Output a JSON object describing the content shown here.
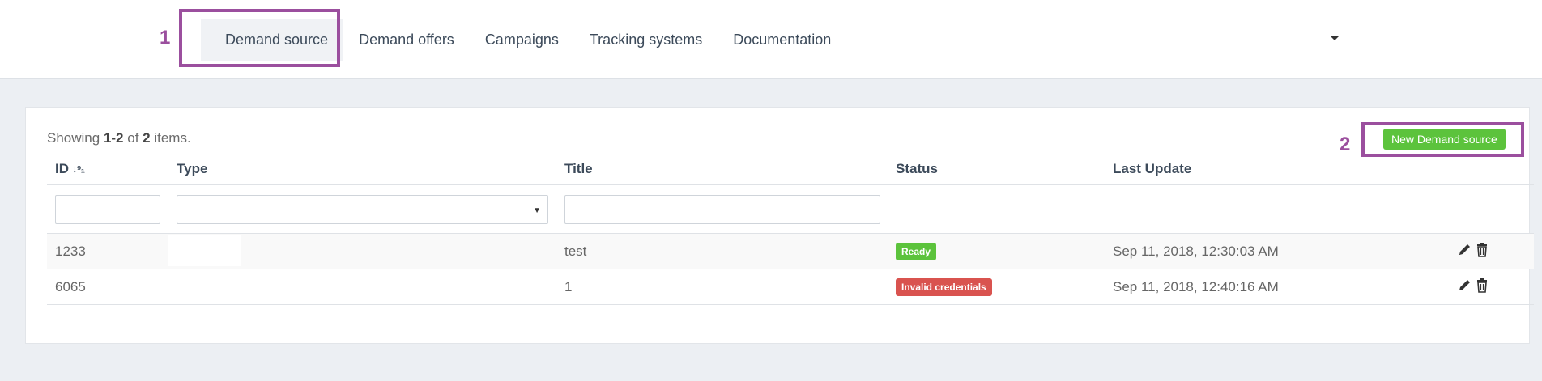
{
  "nav": {
    "items": [
      "Demand source",
      "Demand offers",
      "Campaigns",
      "Tracking systems",
      "Documentation"
    ]
  },
  "annotations": {
    "box1": "1",
    "box2": "2"
  },
  "summary": {
    "prefix": "Showing ",
    "range": "1-2",
    "middle": " of ",
    "total": "2",
    "suffix": " items."
  },
  "new_button": "New Demand source",
  "columns": {
    "id": "ID",
    "type": "Type",
    "title": "Title",
    "status": "Status",
    "last_update": "Last Update"
  },
  "rows": [
    {
      "id": "1233",
      "type": "",
      "title": "test",
      "status": "Ready",
      "status_kind": "ready",
      "last_update": "Sep 11, 2018, 12:30:03 AM"
    },
    {
      "id": "6065",
      "type": "",
      "title": "1",
      "status": "Invalid credentials",
      "status_kind": "invalid",
      "last_update": "Sep 11, 2018, 12:40:16 AM"
    }
  ],
  "colors": {
    "accent": "#9b4f9e",
    "success": "#5cc33c",
    "danger": "#d9534f"
  },
  "icons": [
    "sort-numeric-icon",
    "pencil-icon",
    "trash-icon",
    "chevron-down-icon"
  ]
}
